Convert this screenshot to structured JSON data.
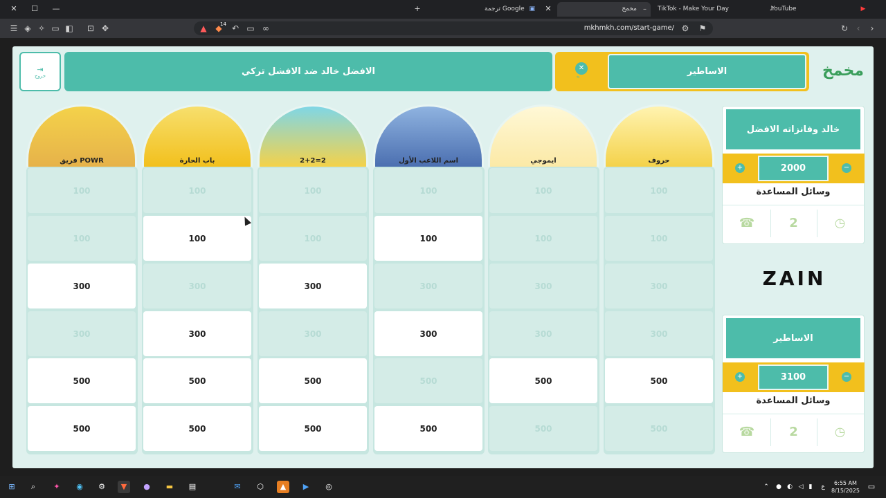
{
  "browser": {
    "tabs": [
      {
        "title": "ترجمة Google",
        "active": false
      },
      {
        "title": "مخمخ",
        "active": true
      },
      {
        "title": "TikTok - Make Your Day",
        "active": false
      },
      {
        "title": "YouTube",
        "active": false
      }
    ],
    "url": "mkhmkh.com/start-game/",
    "badge_count": "14"
  },
  "header": {
    "match_title": "الافضل خالد ضد الافشل تركي",
    "exit_label": "خروج",
    "current_team": "الاساطير",
    "logo_text": "مخمخ"
  },
  "categories": [
    {
      "name": "حروف",
      "values": [
        "100",
        "100",
        "300",
        "300",
        "500",
        "500"
      ],
      "available": [
        false,
        false,
        false,
        false,
        true,
        false
      ]
    },
    {
      "name": "ايموجي",
      "values": [
        "100",
        "100",
        "300",
        "300",
        "500",
        "500"
      ],
      "available": [
        false,
        false,
        false,
        false,
        true,
        false
      ]
    },
    {
      "name": "اسم اللاعب الأول",
      "values": [
        "100",
        "100",
        "300",
        "300",
        "500",
        "500"
      ],
      "available": [
        false,
        true,
        false,
        true,
        false,
        true
      ]
    },
    {
      "name": "2+2=2",
      "values": [
        "100",
        "100",
        "300",
        "300",
        "500",
        "500"
      ],
      "available": [
        false,
        false,
        true,
        false,
        true,
        true
      ]
    },
    {
      "name": "باب الحارة",
      "values": [
        "100",
        "100",
        "300",
        "300",
        "500",
        "500"
      ],
      "available": [
        false,
        true,
        false,
        true,
        true,
        true
      ]
    },
    {
      "name": "فريق POWR",
      "values": [
        "100",
        "100",
        "300",
        "300",
        "500",
        "500"
      ],
      "available": [
        false,
        false,
        true,
        false,
        true,
        true
      ]
    }
  ],
  "teams": [
    {
      "name": "خالد وفانزاته الافضل",
      "score": "2000",
      "help_label": "وسائل المساعدة"
    },
    {
      "name": "الاساطير",
      "score": "3100",
      "help_label": "وسائل المساعدة"
    }
  ],
  "sponsor": "ZAIN",
  "taskbar": {
    "time": "6:55 AM",
    "date": "8/15/2025"
  },
  "colors": {
    "primary": "#4dbcaa",
    "accent": "#f2c01d",
    "board_bg": "#dff1ee"
  }
}
